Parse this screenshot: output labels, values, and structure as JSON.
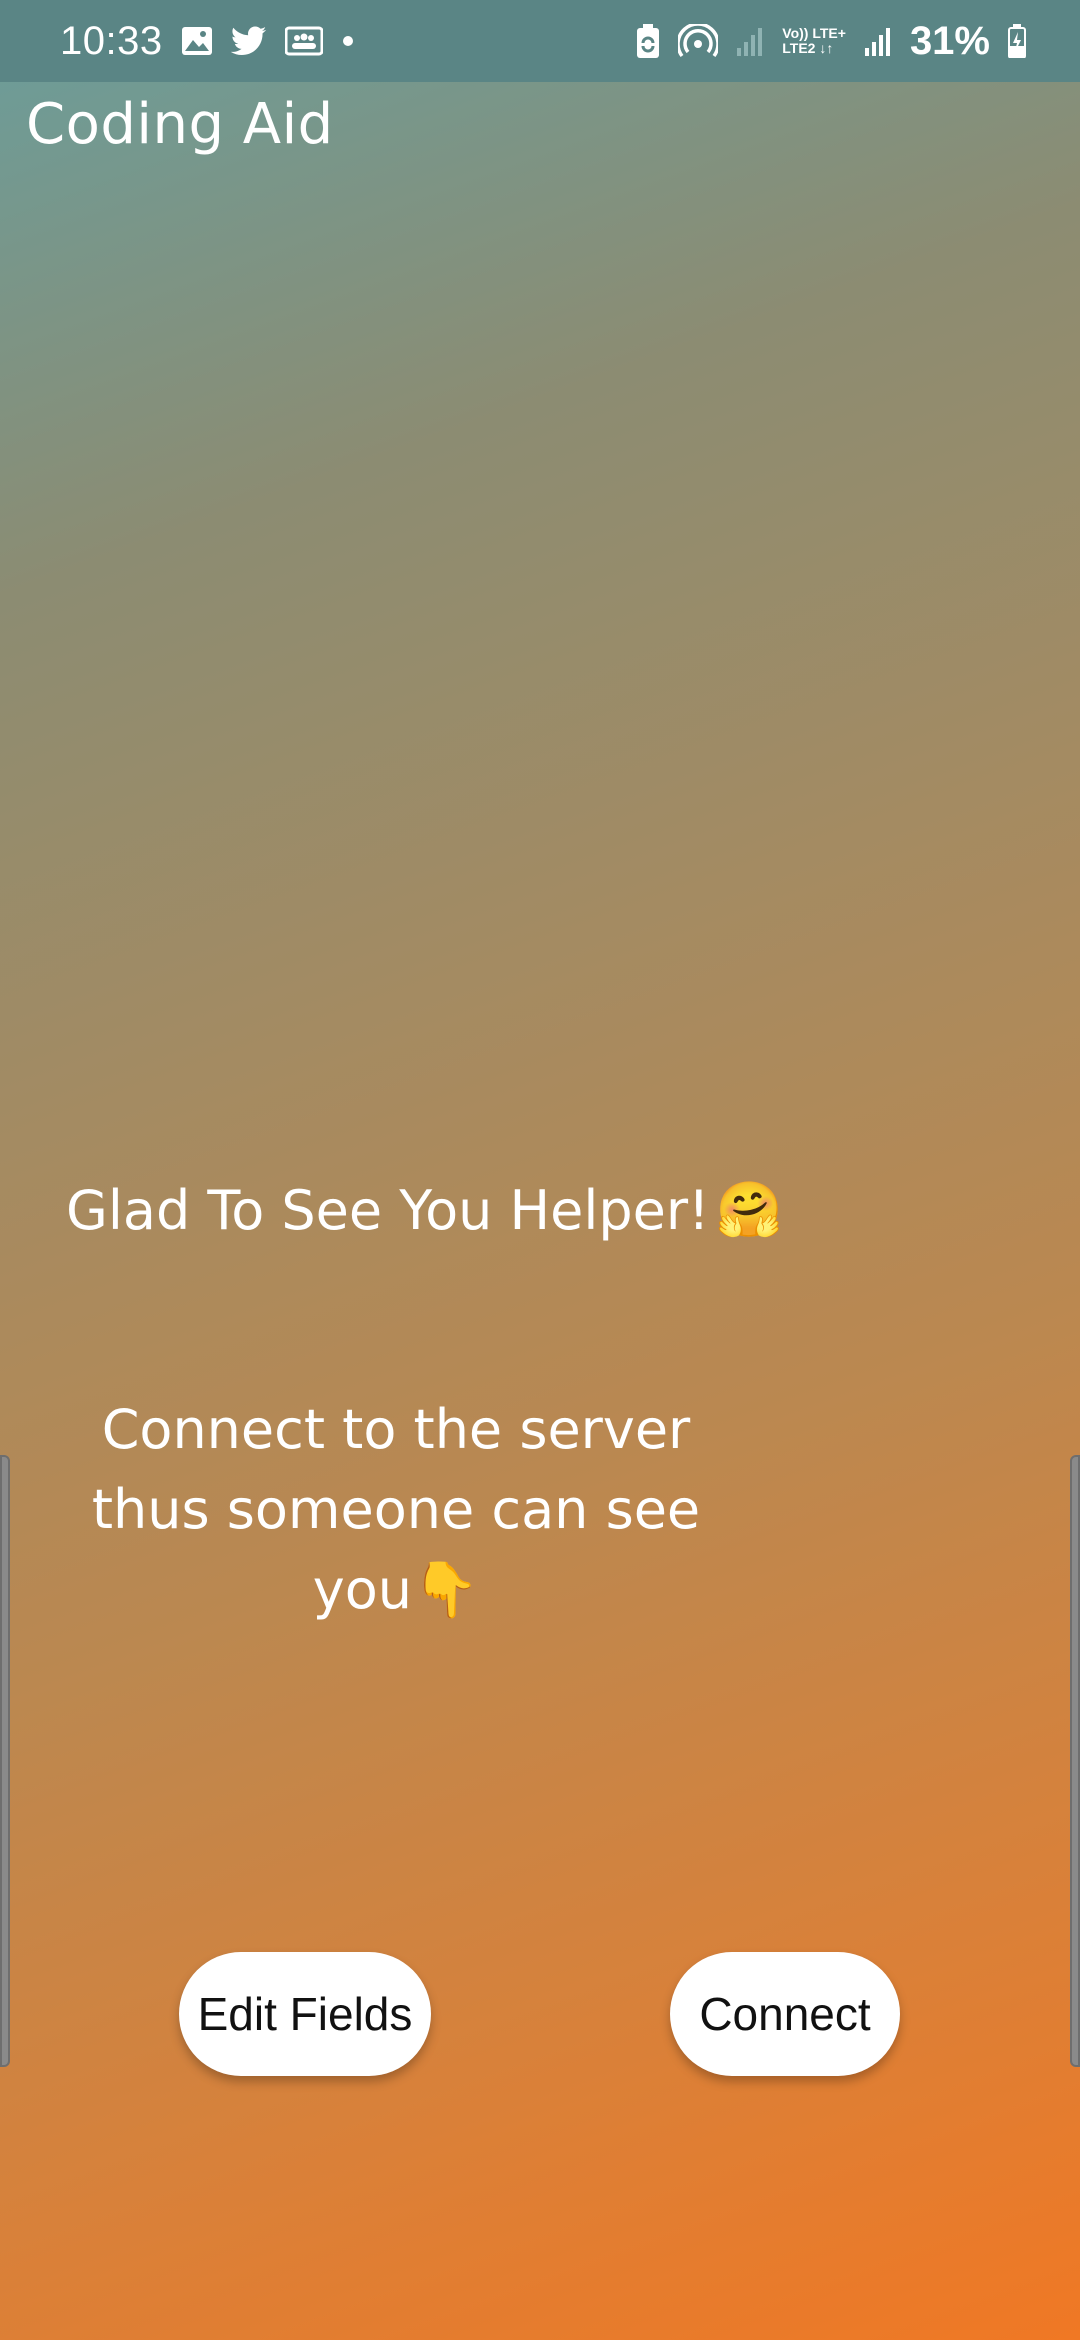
{
  "status_bar": {
    "time": "10:33",
    "network_type_top": "Vo)) LTE+",
    "network_type_bottom": "LTE2 ↓↑",
    "battery_percent": "31%",
    "notification_icons": [
      "image-icon",
      "twitter-icon",
      "group-icon",
      "dot-icon"
    ],
    "system_icons": [
      "battery-saver-icon",
      "hotspot-icon",
      "signal-weak-icon",
      "signal-icon",
      "battery-charging-icon"
    ]
  },
  "app": {
    "title": "Coding Aid"
  },
  "main": {
    "greeting": "Glad To See You Helper!",
    "greeting_emoji": "🤗",
    "connect_message": "Connect to the server thus someone can see you",
    "connect_emoji": "👇"
  },
  "buttons": {
    "edit_fields": "Edit Fields",
    "connect": "Connect"
  },
  "colors": {
    "status_bar": "#5a8585",
    "gradient_top": "#6a9e9c",
    "gradient_bottom": "#f07824",
    "text": "#ffffff",
    "button_bg": "#ffffff"
  }
}
